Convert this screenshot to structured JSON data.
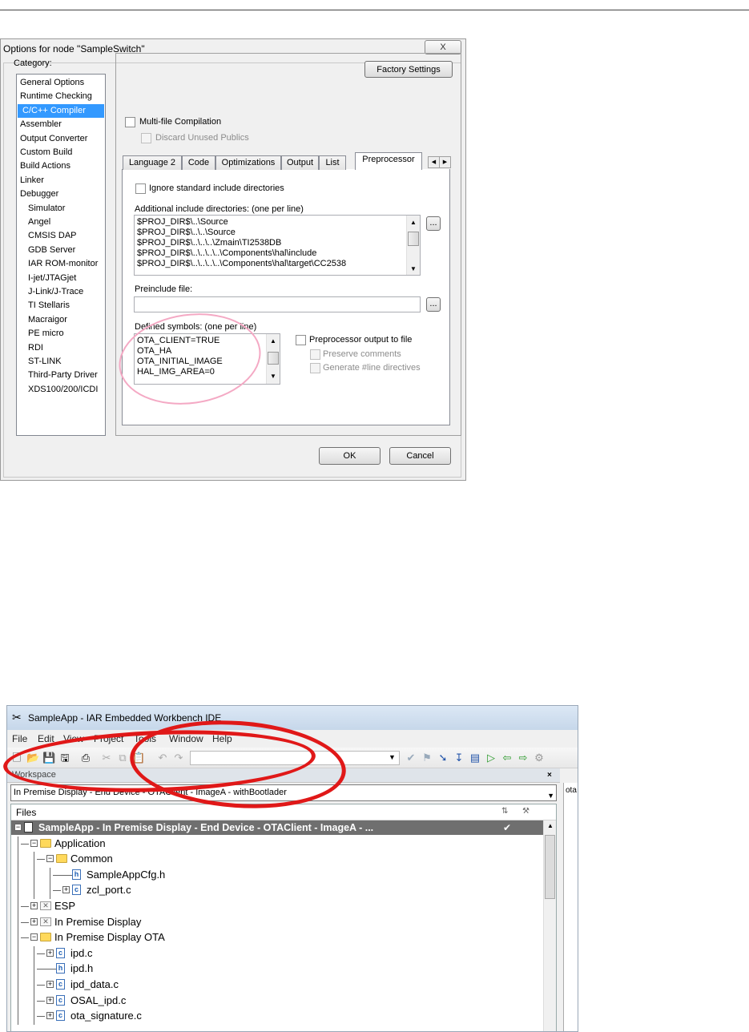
{
  "dialog": {
    "title": "Options for node \"SampleSwitch\"",
    "close_glyph": "X",
    "category_label": "Category:",
    "categories": [
      {
        "label": "General Options"
      },
      {
        "label": "Runtime Checking"
      },
      {
        "label": "C/C++ Compiler",
        "selected": true
      },
      {
        "label": "Assembler"
      },
      {
        "label": "Output Converter"
      },
      {
        "label": "Custom Build"
      },
      {
        "label": "Build Actions"
      },
      {
        "label": "Linker"
      },
      {
        "label": "Debugger"
      },
      {
        "label": "Simulator",
        "sub": true
      },
      {
        "label": "Angel",
        "sub": true
      },
      {
        "label": "CMSIS DAP",
        "sub": true
      },
      {
        "label": "GDB Server",
        "sub": true
      },
      {
        "label": "IAR ROM-monitor",
        "sub": true
      },
      {
        "label": "I-jet/JTAGjet",
        "sub": true
      },
      {
        "label": "J-Link/J-Trace",
        "sub": true
      },
      {
        "label": "TI Stellaris",
        "sub": true
      },
      {
        "label": "Macraigor",
        "sub": true
      },
      {
        "label": "PE micro",
        "sub": true
      },
      {
        "label": "RDI",
        "sub": true
      },
      {
        "label": "ST-LINK",
        "sub": true
      },
      {
        "label": "Third-Party Driver",
        "sub": true
      },
      {
        "label": "XDS100/200/ICDI",
        "sub": true
      }
    ],
    "factory_settings": "Factory Settings",
    "multifile_label": "Multi-file Compilation",
    "discard_label": "Discard Unused Publics",
    "tabs": [
      "Language 2",
      "Code",
      "Optimizations",
      "Output",
      "List",
      "Preprocessor"
    ],
    "active_tab": "Preprocessor",
    "ignore_std_label": "Ignore standard include directories",
    "include_dirs_label": "Additional include directories: (one per line)",
    "include_dirs": [
      "$PROJ_DIR$\\..\\Source",
      "$PROJ_DIR$\\..\\..\\Source",
      "$PROJ_DIR$\\..\\..\\..\\Zmain\\TI2538DB",
      "$PROJ_DIR$\\..\\..\\..\\..\\Components\\hal\\include",
      "$PROJ_DIR$\\..\\..\\..\\..\\Components\\hal\\target\\CC2538"
    ],
    "preinclude_label": "Preinclude file:",
    "preinclude_value": "",
    "defined_label": "Defined symbols: (one per line)",
    "defined_symbols": [
      "OTA_CLIENT=TRUE",
      "OTA_HA",
      "OTA_INITIAL_IMAGE",
      "HAL_IMG_AREA=0"
    ],
    "preproc_output_label": "Preprocessor output to file",
    "preserve_comments_label": "Preserve comments",
    "generate_line_label": "Generate #line directives",
    "ellipsis": "...",
    "ok": "OK",
    "cancel": "Cancel",
    "highlight_color": "#f4a9c4"
  },
  "ide": {
    "title": "SampleApp - IAR Embedded Workbench IDE",
    "menu": [
      "File",
      "Edit",
      "View",
      "Project",
      "Tools",
      "Window",
      "Help"
    ],
    "workspace_label": "Workspace",
    "close_glyph": "×",
    "config": "In Premise Display - End Device - OTAClient - ImageA - withBootlader",
    "files_label": "Files",
    "right_tab": "ota",
    "tree": [
      {
        "label": "SampleApp - In Premise Display - End Device - OTAClient - ImageA - ...",
        "kind": "project",
        "check": "✔"
      },
      {
        "label": "Application",
        "kind": "folder"
      },
      {
        "label": "Common",
        "kind": "folder"
      },
      {
        "label": "SampleAppCfg.h",
        "kind": "h"
      },
      {
        "label": "zcl_port.c",
        "kind": "c"
      },
      {
        "label": "ESP",
        "kind": "xfolder"
      },
      {
        "label": "In Premise Display",
        "kind": "xfolder"
      },
      {
        "label": "In Premise Display OTA",
        "kind": "folder"
      },
      {
        "label": "ipd.c",
        "kind": "c"
      },
      {
        "label": "ipd.h",
        "kind": "h"
      },
      {
        "label": "ipd_data.c",
        "kind": "c"
      },
      {
        "label": "OSAL_ipd.c",
        "kind": "c"
      },
      {
        "label": "ota_signature.c",
        "kind": "c"
      }
    ],
    "highlight_color": "#e01818"
  }
}
